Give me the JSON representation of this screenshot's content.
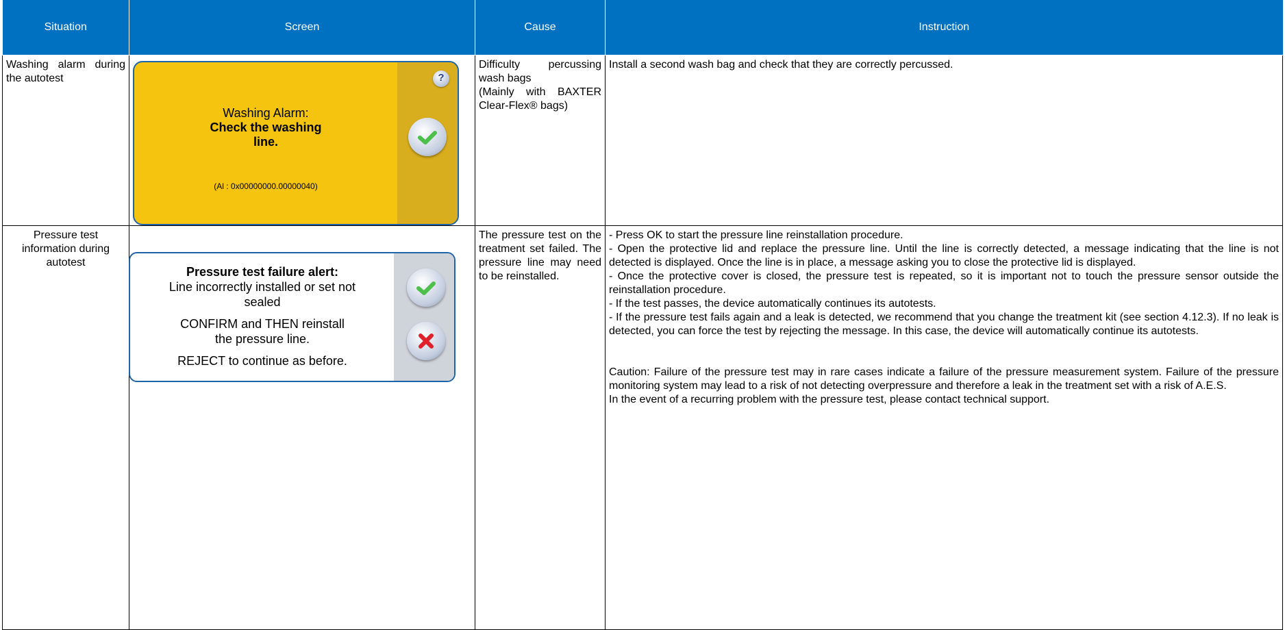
{
  "headers": [
    "Situation",
    "Screen",
    "Cause",
    "Instruction"
  ],
  "rows": [
    {
      "situation": "Washing alarm during the autotest",
      "screen": {
        "line1": "Washing Alarm:",
        "line2": "Check the washing",
        "line3": "line.",
        "code": "(Al : 0x00000000.00000040)",
        "help_icon": "help-icon",
        "confirm_icon": "checkmark-icon",
        "colors": {
          "background": "#f4c40f",
          "side_panel": "#d9ae1e",
          "border": "#1f63a8"
        }
      },
      "cause": [
        "Difficulty percussing wash bags",
        "(Mainly with BAXTER Clear-Flex® bags)"
      ],
      "instruction": [
        "Install a second wash bag and check that they are correctly percussed."
      ]
    },
    {
      "situation": "Pressure test information during autotest",
      "screen": {
        "title": "Pressure test failure alert:",
        "line1": "Line incorrectly installed or set not",
        "line2": "sealed",
        "line3": "CONFIRM and THEN reinstall",
        "line4": "the pressure line.",
        "line5": "REJECT to continue as before.",
        "confirm_icon": "checkmark-icon",
        "reject_icon": "cross-icon",
        "colors": {
          "background": "#ffffff",
          "side_panel": "#cfd3da",
          "border": "#1f63a8"
        }
      },
      "cause": [
        "The pressure test on the treatment set failed. The pressure line may need to be reinstalled."
      ],
      "instruction": [
        "- Press OK to start the pressure line reinstallation procedure.",
        "- Open the protective lid and replace the pressure line. Until the line is correctly detected, a message indicating that the line is not detected is displayed. Once the line is in place, a message asking you to close the protective lid is displayed.",
        "- Once the protective cover is closed, the pressure test is repeated, so it is important not to touch the pressure sensor outside the reinstallation procedure.",
        "- If the test passes, the device automatically continues its autotests.",
        "- If the pressure test fails again and a leak is detected, we recommend that you change the treatment kit (see section 4.12.3). If no leak is detected, you can force the test by rejecting the message. In this case, the device will automatically continue its autotests.",
        "Caution: Failure of the pressure test may in rare cases indicate a failure of the pressure measurement system. Failure of the pressure monitoring system may lead to a risk of not detecting overpressure and therefore a leak in the treatment set with a risk of A.E.S.",
        "In the event of a recurring problem with the pressure test, please contact technical support."
      ]
    }
  ],
  "colors": {
    "header_bg": "#0070c0",
    "header_text": "#ffffff",
    "border": "#000000"
  }
}
